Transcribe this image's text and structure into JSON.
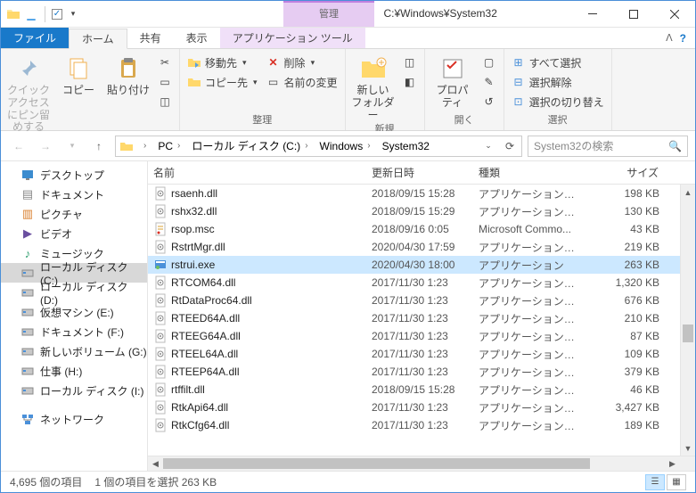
{
  "window": {
    "title": "C:¥Windows¥System32",
    "context_tab_upper": "管理",
    "context_tab_lower": "アプリケーション ツール"
  },
  "tabs": {
    "file": "ファイル",
    "home": "ホーム",
    "share": "共有",
    "view": "表示"
  },
  "ribbon": {
    "clipboard": {
      "label": "クリップボード",
      "pin": "クイック アクセス\nにピン留めする",
      "copy": "コピー",
      "paste": "貼り付け"
    },
    "organize": {
      "label": "整理",
      "move_to": "移動先",
      "delete": "削除",
      "copy_to": "コピー先",
      "rename": "名前の変更"
    },
    "new": {
      "label": "新規",
      "new_folder": "新しい\nフォルダー"
    },
    "open": {
      "label": "開く",
      "properties": "プロパ\nティ"
    },
    "select": {
      "label": "選択",
      "select_all": "すべて選択",
      "select_none": "選択解除",
      "invert": "選択の切り替え"
    }
  },
  "breadcrumb": {
    "pc": "PC",
    "drive": "ローカル ディスク (C:)",
    "windows": "Windows",
    "sys32": "System32"
  },
  "search": {
    "placeholder": "System32の検索"
  },
  "sidebar": {
    "items": [
      {
        "label": "デスクトップ"
      },
      {
        "label": "ドキュメント"
      },
      {
        "label": "ピクチャ"
      },
      {
        "label": "ビデオ"
      },
      {
        "label": "ミュージック"
      },
      {
        "label": "ローカル ディスク (C:)"
      },
      {
        "label": "ローカル ディスク (D:)"
      },
      {
        "label": "仮想マシン (E:)"
      },
      {
        "label": "ドキュメント (F:)"
      },
      {
        "label": "新しいボリューム (G:)"
      },
      {
        "label": "仕事 (H:)"
      },
      {
        "label": "ローカル ディスク (I:)"
      }
    ],
    "network": "ネットワーク"
  },
  "columns": {
    "name": "名前",
    "date": "更新日時",
    "type": "種類",
    "size": "サイズ"
  },
  "files": [
    {
      "n": "rsaenh.dll",
      "d": "2018/09/15 15:28",
      "t": "アプリケーション拡張",
      "s": "198 KB",
      "k": "dll"
    },
    {
      "n": "rshx32.dll",
      "d": "2018/09/15 15:29",
      "t": "アプリケーション拡張",
      "s": "130 KB",
      "k": "dll"
    },
    {
      "n": "rsop.msc",
      "d": "2018/09/16 0:05",
      "t": "Microsoft Commo...",
      "s": "43 KB",
      "k": "msc"
    },
    {
      "n": "RstrtMgr.dll",
      "d": "2020/04/30 17:59",
      "t": "アプリケーション拡張",
      "s": "219 KB",
      "k": "dll"
    },
    {
      "n": "rstrui.exe",
      "d": "2020/04/30 18:00",
      "t": "アプリケーション",
      "s": "263 KB",
      "k": "exe",
      "sel": true
    },
    {
      "n": "RTCOM64.dll",
      "d": "2017/11/30 1:23",
      "t": "アプリケーション拡張",
      "s": "1,320 KB",
      "k": "dll"
    },
    {
      "n": "RtDataProc64.dll",
      "d": "2017/11/30 1:23",
      "t": "アプリケーション拡張",
      "s": "676 KB",
      "k": "dll"
    },
    {
      "n": "RTEED64A.dll",
      "d": "2017/11/30 1:23",
      "t": "アプリケーション拡張",
      "s": "210 KB",
      "k": "dll"
    },
    {
      "n": "RTEEG64A.dll",
      "d": "2017/11/30 1:23",
      "t": "アプリケーション拡張",
      "s": "87 KB",
      "k": "dll"
    },
    {
      "n": "RTEEL64A.dll",
      "d": "2017/11/30 1:23",
      "t": "アプリケーション拡張",
      "s": "109 KB",
      "k": "dll"
    },
    {
      "n": "RTEEP64A.dll",
      "d": "2017/11/30 1:23",
      "t": "アプリケーション拡張",
      "s": "379 KB",
      "k": "dll"
    },
    {
      "n": "rtffilt.dll",
      "d": "2018/09/15 15:28",
      "t": "アプリケーション拡張",
      "s": "46 KB",
      "k": "dll"
    },
    {
      "n": "RtkApi64.dll",
      "d": "2017/11/30 1:23",
      "t": "アプリケーション拡張",
      "s": "3,427 KB",
      "k": "dll"
    },
    {
      "n": "RtkCfg64.dll",
      "d": "2017/11/30 1:23",
      "t": "アプリケーション拡張",
      "s": "189 KB",
      "k": "dll"
    }
  ],
  "status": {
    "count": "4,695 個の項目",
    "selection": "1 個の項目を選択 263 KB"
  }
}
